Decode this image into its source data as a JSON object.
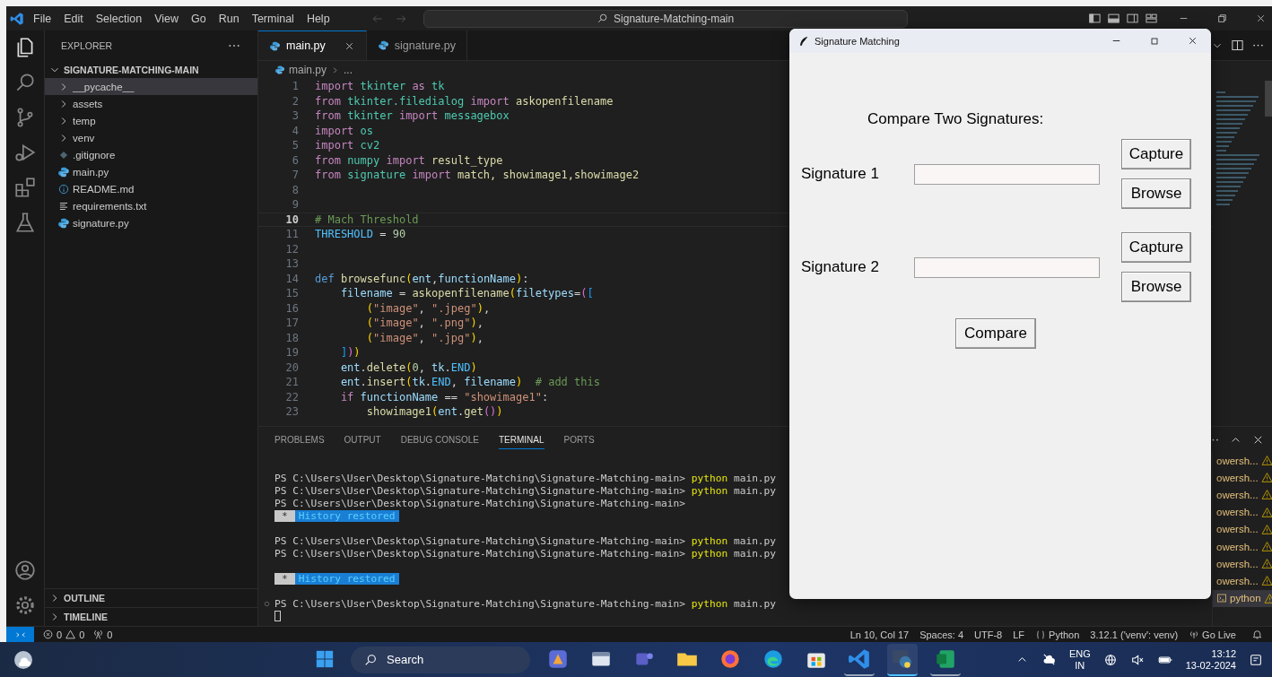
{
  "titlebar": {
    "menu": [
      "File",
      "Edit",
      "Selection",
      "View",
      "Go",
      "Run",
      "Terminal",
      "Help"
    ],
    "search": "Signature-Matching-main"
  },
  "activity_bar": {
    "items": [
      {
        "kind": "files",
        "selected": true
      },
      {
        "kind": "search",
        "selected": false
      },
      {
        "kind": "source-control",
        "selected": false
      },
      {
        "kind": "run-debug",
        "selected": false
      },
      {
        "kind": "extensions",
        "selected": false
      },
      {
        "kind": "testing",
        "selected": false
      }
    ],
    "bottom": [
      {
        "kind": "account"
      },
      {
        "kind": "settings"
      }
    ]
  },
  "sidebar": {
    "title": "EXPLORER",
    "root": {
      "label": "SIGNATURE-MATCHING-MAIN",
      "expanded": true,
      "children": [
        {
          "label": "__pycache__",
          "kind": "folder",
          "expanded": false,
          "selected": true
        },
        {
          "label": "assets",
          "kind": "folder",
          "expanded": false,
          "selected": false
        },
        {
          "label": "temp",
          "kind": "folder",
          "expanded": false,
          "selected": false
        },
        {
          "label": "venv",
          "kind": "folder",
          "expanded": false,
          "selected": false
        },
        {
          "label": ".gitignore",
          "kind": "git",
          "selected": false
        },
        {
          "label": "main.py",
          "kind": "python",
          "selected": false
        },
        {
          "label": "README.md",
          "kind": "info",
          "selected": false
        },
        {
          "label": "requirements.txt",
          "kind": "text",
          "selected": false
        },
        {
          "label": "signature.py",
          "kind": "python",
          "selected": false
        }
      ]
    },
    "sections": [
      {
        "label": "OUTLINE",
        "expanded": false
      },
      {
        "label": "TIMELINE",
        "expanded": false
      }
    ]
  },
  "editor": {
    "tabs": [
      {
        "label": "main.py",
        "selected": true
      },
      {
        "label": "signature.py",
        "selected": false
      }
    ],
    "breadcrumb": [
      "main.py",
      "..."
    ],
    "lines": [
      {
        "n": "1",
        "current": false,
        "tokens": [
          {
            "kind": "kw",
            "text": "import "
          },
          {
            "kind": "mod",
            "text": "tkinter "
          },
          {
            "kind": "kw",
            "text": "as "
          },
          {
            "kind": "mod",
            "text": "tk"
          }
        ]
      },
      {
        "n": "2",
        "current": false,
        "tokens": [
          {
            "kind": "kw",
            "text": "from "
          },
          {
            "kind": "mod",
            "text": "tkinter.filedialog "
          },
          {
            "kind": "kw",
            "text": "import "
          },
          {
            "kind": "fn",
            "text": "askopenfilename"
          }
        ]
      },
      {
        "n": "3",
        "current": false,
        "tokens": [
          {
            "kind": "kw",
            "text": "from "
          },
          {
            "kind": "mod",
            "text": "tkinter "
          },
          {
            "kind": "kw",
            "text": "import "
          },
          {
            "kind": "mod",
            "text": "messagebox"
          }
        ]
      },
      {
        "n": "4",
        "current": false,
        "tokens": [
          {
            "kind": "kw",
            "text": "import "
          },
          {
            "kind": "mod",
            "text": "os"
          }
        ]
      },
      {
        "n": "5",
        "current": false,
        "tokens": [
          {
            "kind": "kw",
            "text": "import "
          },
          {
            "kind": "mod",
            "text": "cv2"
          }
        ]
      },
      {
        "n": "6",
        "current": false,
        "tokens": [
          {
            "kind": "kw",
            "text": "from "
          },
          {
            "kind": "mod",
            "text": "numpy "
          },
          {
            "kind": "kw",
            "text": "import "
          },
          {
            "kind": "fn",
            "text": "result_type"
          }
        ]
      },
      {
        "n": "7",
        "current": false,
        "tokens": [
          {
            "kind": "kw",
            "text": "from "
          },
          {
            "kind": "mod",
            "text": "signature "
          },
          {
            "kind": "kw",
            "text": "import "
          },
          {
            "kind": "fn",
            "text": "match, showimage1,showimage2"
          }
        ]
      },
      {
        "n": "8",
        "current": false
      },
      {
        "n": "9",
        "current": false
      },
      {
        "n": "10",
        "current": true,
        "tokens": [
          {
            "kind": "cm",
            "text": "# Mach Threshold"
          }
        ]
      },
      {
        "n": "11",
        "current": false,
        "tokens": [
          {
            "kind": "const",
            "text": "THRESHOLD"
          },
          {
            "kind": "plain",
            "text": " = "
          },
          {
            "kind": "num",
            "text": "90"
          }
        ]
      },
      {
        "n": "12",
        "current": false
      },
      {
        "n": "13",
        "current": false
      },
      {
        "n": "14",
        "current": false,
        "tokens": [
          {
            "kind": "def",
            "text": "def "
          },
          {
            "kind": "fn",
            "text": "browsefunc"
          },
          {
            "kind": "b1",
            "text": "("
          },
          {
            "kind": "var",
            "text": "ent"
          },
          {
            "kind": "plain",
            "text": ","
          },
          {
            "kind": "var",
            "text": "functionName"
          },
          {
            "kind": "b1",
            "text": ")"
          },
          {
            "kind": "plain",
            "text": ":"
          }
        ]
      },
      {
        "n": "15",
        "current": false,
        "tokens": [
          {
            "kind": "var",
            "text": "    filename"
          },
          {
            "kind": "plain",
            "text": " = "
          },
          {
            "kind": "fn",
            "text": "askopenfilename"
          },
          {
            "kind": "b1",
            "text": "("
          },
          {
            "kind": "var",
            "text": "filetypes"
          },
          {
            "kind": "plain",
            "text": "="
          },
          {
            "kind": "b2",
            "text": "("
          },
          {
            "kind": "b3",
            "text": "["
          }
        ]
      },
      {
        "n": "16",
        "current": false,
        "tokens": [
          {
            "kind": "b1",
            "text": "        ("
          },
          {
            "kind": "str",
            "text": "\"image\""
          },
          {
            "kind": "plain",
            "text": ", "
          },
          {
            "kind": "str",
            "text": "\".jpeg\""
          },
          {
            "kind": "b1",
            "text": ")"
          },
          {
            "kind": "plain",
            "text": ","
          }
        ]
      },
      {
        "n": "17",
        "current": false,
        "tokens": [
          {
            "kind": "b1",
            "text": "        ("
          },
          {
            "kind": "str",
            "text": "\"image\""
          },
          {
            "kind": "plain",
            "text": ", "
          },
          {
            "kind": "str",
            "text": "\".png\""
          },
          {
            "kind": "b1",
            "text": ")"
          },
          {
            "kind": "plain",
            "text": ","
          }
        ]
      },
      {
        "n": "18",
        "current": false,
        "tokens": [
          {
            "kind": "b1",
            "text": "        ("
          },
          {
            "kind": "str",
            "text": "\"image\""
          },
          {
            "kind": "plain",
            "text": ", "
          },
          {
            "kind": "str",
            "text": "\".jpg\""
          },
          {
            "kind": "b1",
            "text": ")"
          },
          {
            "kind": "plain",
            "text": ","
          }
        ]
      },
      {
        "n": "19",
        "current": false,
        "tokens": [
          {
            "kind": "b3",
            "text": "    ]"
          },
          {
            "kind": "b2",
            "text": ")"
          },
          {
            "kind": "b1",
            "text": ")"
          }
        ]
      },
      {
        "n": "20",
        "current": false,
        "tokens": [
          {
            "kind": "var",
            "text": "    ent"
          },
          {
            "kind": "plain",
            "text": "."
          },
          {
            "kind": "fn",
            "text": "delete"
          },
          {
            "kind": "b1",
            "text": "("
          },
          {
            "kind": "num",
            "text": "0"
          },
          {
            "kind": "plain",
            "text": ", "
          },
          {
            "kind": "var",
            "text": "tk"
          },
          {
            "kind": "plain",
            "text": "."
          },
          {
            "kind": "const",
            "text": "END"
          },
          {
            "kind": "b1",
            "text": ")"
          }
        ]
      },
      {
        "n": "21",
        "current": false,
        "tokens": [
          {
            "kind": "var",
            "text": "    ent"
          },
          {
            "kind": "plain",
            "text": "."
          },
          {
            "kind": "fn",
            "text": "insert"
          },
          {
            "kind": "b1",
            "text": "("
          },
          {
            "kind": "var",
            "text": "tk"
          },
          {
            "kind": "plain",
            "text": "."
          },
          {
            "kind": "const",
            "text": "END"
          },
          {
            "kind": "plain",
            "text": ", "
          },
          {
            "kind": "var",
            "text": "filename"
          },
          {
            "kind": "b1",
            "text": ")"
          },
          {
            "kind": "cm",
            "text": "  # add this"
          }
        ]
      },
      {
        "n": "22",
        "current": false,
        "tokens": [
          {
            "kind": "kw",
            "text": "    if "
          },
          {
            "kind": "var",
            "text": "functionName"
          },
          {
            "kind": "plain",
            "text": " == "
          },
          {
            "kind": "str",
            "text": "\"showimage1\""
          },
          {
            "kind": "plain",
            "text": ":"
          }
        ]
      },
      {
        "n": "23",
        "current": false,
        "tokens": [
          {
            "kind": "fn",
            "text": "        showimage1"
          },
          {
            "kind": "b1",
            "text": "("
          },
          {
            "kind": "var",
            "text": "ent"
          },
          {
            "kind": "plain",
            "text": "."
          },
          {
            "kind": "fn",
            "text": "get"
          },
          {
            "kind": "b2",
            "text": "()"
          },
          {
            "kind": "b1",
            "text": ")"
          }
        ]
      }
    ]
  },
  "panel": {
    "tabs": [
      {
        "label": "PROBLEMS",
        "selected": false
      },
      {
        "label": "OUTPUT",
        "selected": false
      },
      {
        "label": "DEBUG CONSOLE",
        "selected": false
      },
      {
        "label": "TERMINAL",
        "selected": true
      },
      {
        "label": "PORTS",
        "selected": false
      }
    ],
    "terminal": [
      {
        "kind": "prompt",
        "prompt": "PS C:\\Users\\User\\Desktop\\Signature-Matching\\Signature-Matching-main>",
        "command": "python",
        "args": "main.py"
      },
      {
        "kind": "prompt",
        "prompt": "PS C:\\Users\\User\\Desktop\\Signature-Matching\\Signature-Matching-main>",
        "command": "python",
        "args": "main.py"
      },
      {
        "kind": "prompt",
        "prompt": "PS C:\\Users\\User\\Desktop\\Signature-Matching\\Signature-Matching-main>"
      },
      {
        "kind": "notice",
        "badge": "*",
        "text": "History restored"
      },
      {
        "kind": "blank"
      },
      {
        "kind": "prompt",
        "prompt": "PS C:\\Users\\User\\Desktop\\Signature-Matching\\Signature-Matching-main>",
        "command": "python",
        "args": "main.py"
      },
      {
        "kind": "prompt",
        "prompt": "PS C:\\Users\\User\\Desktop\\Signature-Matching\\Signature-Matching-main>",
        "command": "python",
        "args": "main.py"
      },
      {
        "kind": "blank"
      },
      {
        "kind": "notice",
        "badge": "*",
        "text": "History restored"
      },
      {
        "kind": "blank"
      },
      {
        "kind": "prompt",
        "marker": true,
        "prompt": "PS C:\\Users\\User\\Desktop\\Signature-Matching\\Signature-Matching-main>",
        "command": "python",
        "args": "main.py"
      },
      {
        "kind": "cursor"
      }
    ],
    "terminals": [
      {
        "label": "owersh...",
        "selected": false
      },
      {
        "label": "owersh...",
        "selected": false
      },
      {
        "label": "owersh...",
        "selected": false
      },
      {
        "label": "owersh...",
        "selected": false
      },
      {
        "label": "owersh...",
        "selected": false
      },
      {
        "label": "owersh...",
        "selected": false
      },
      {
        "label": "owersh...",
        "selected": false
      },
      {
        "label": "owersh...",
        "selected": false
      },
      {
        "label": "python",
        "selected": true
      }
    ]
  },
  "status_bar": {
    "errors": "0",
    "warnings": "0",
    "ports": "0",
    "right": [
      {
        "kind": "text",
        "text": "Ln 10, Col 17"
      },
      {
        "kind": "text",
        "text": "Spaces: 4"
      },
      {
        "kind": "text",
        "text": "UTF-8"
      },
      {
        "kind": "text",
        "text": "LF"
      },
      {
        "kind": "language",
        "text": "Python"
      },
      {
        "kind": "text",
        "text": "3.12.1 ('venv': venv)"
      },
      {
        "kind": "live",
        "text": "Go Live"
      },
      {
        "kind": "bell"
      }
    ]
  },
  "taskbar": {
    "search": "Search",
    "apps": [
      {
        "kind": "colorful",
        "running": false,
        "selected": false
      },
      {
        "kind": "window",
        "running": false,
        "selected": false
      },
      {
        "kind": "teams",
        "running": false,
        "selected": false
      },
      {
        "kind": "folder",
        "running": false,
        "selected": false
      },
      {
        "kind": "firefox",
        "running": false,
        "selected": false
      },
      {
        "kind": "edge",
        "running": false,
        "selected": false
      },
      {
        "kind": "store",
        "running": false,
        "selected": false
      },
      {
        "kind": "vscode",
        "running": true,
        "selected": false
      },
      {
        "kind": "pyapp",
        "running": true,
        "selected": true
      },
      {
        "kind": "excel",
        "running": true,
        "selected": false
      }
    ],
    "language": [
      "ENG",
      "IN"
    ],
    "time": "13:12",
    "date": "13-02-2024"
  },
  "dialog": {
    "title": "Signature Matching",
    "heading": "Compare Two Signatures:",
    "rows": [
      {
        "label": "Signature 1",
        "buttons": [
          "Capture",
          "Browse"
        ]
      },
      {
        "label": "Signature 2",
        "buttons": [
          "Capture",
          "Browse"
        ]
      }
    ],
    "compare": "Compare"
  }
}
